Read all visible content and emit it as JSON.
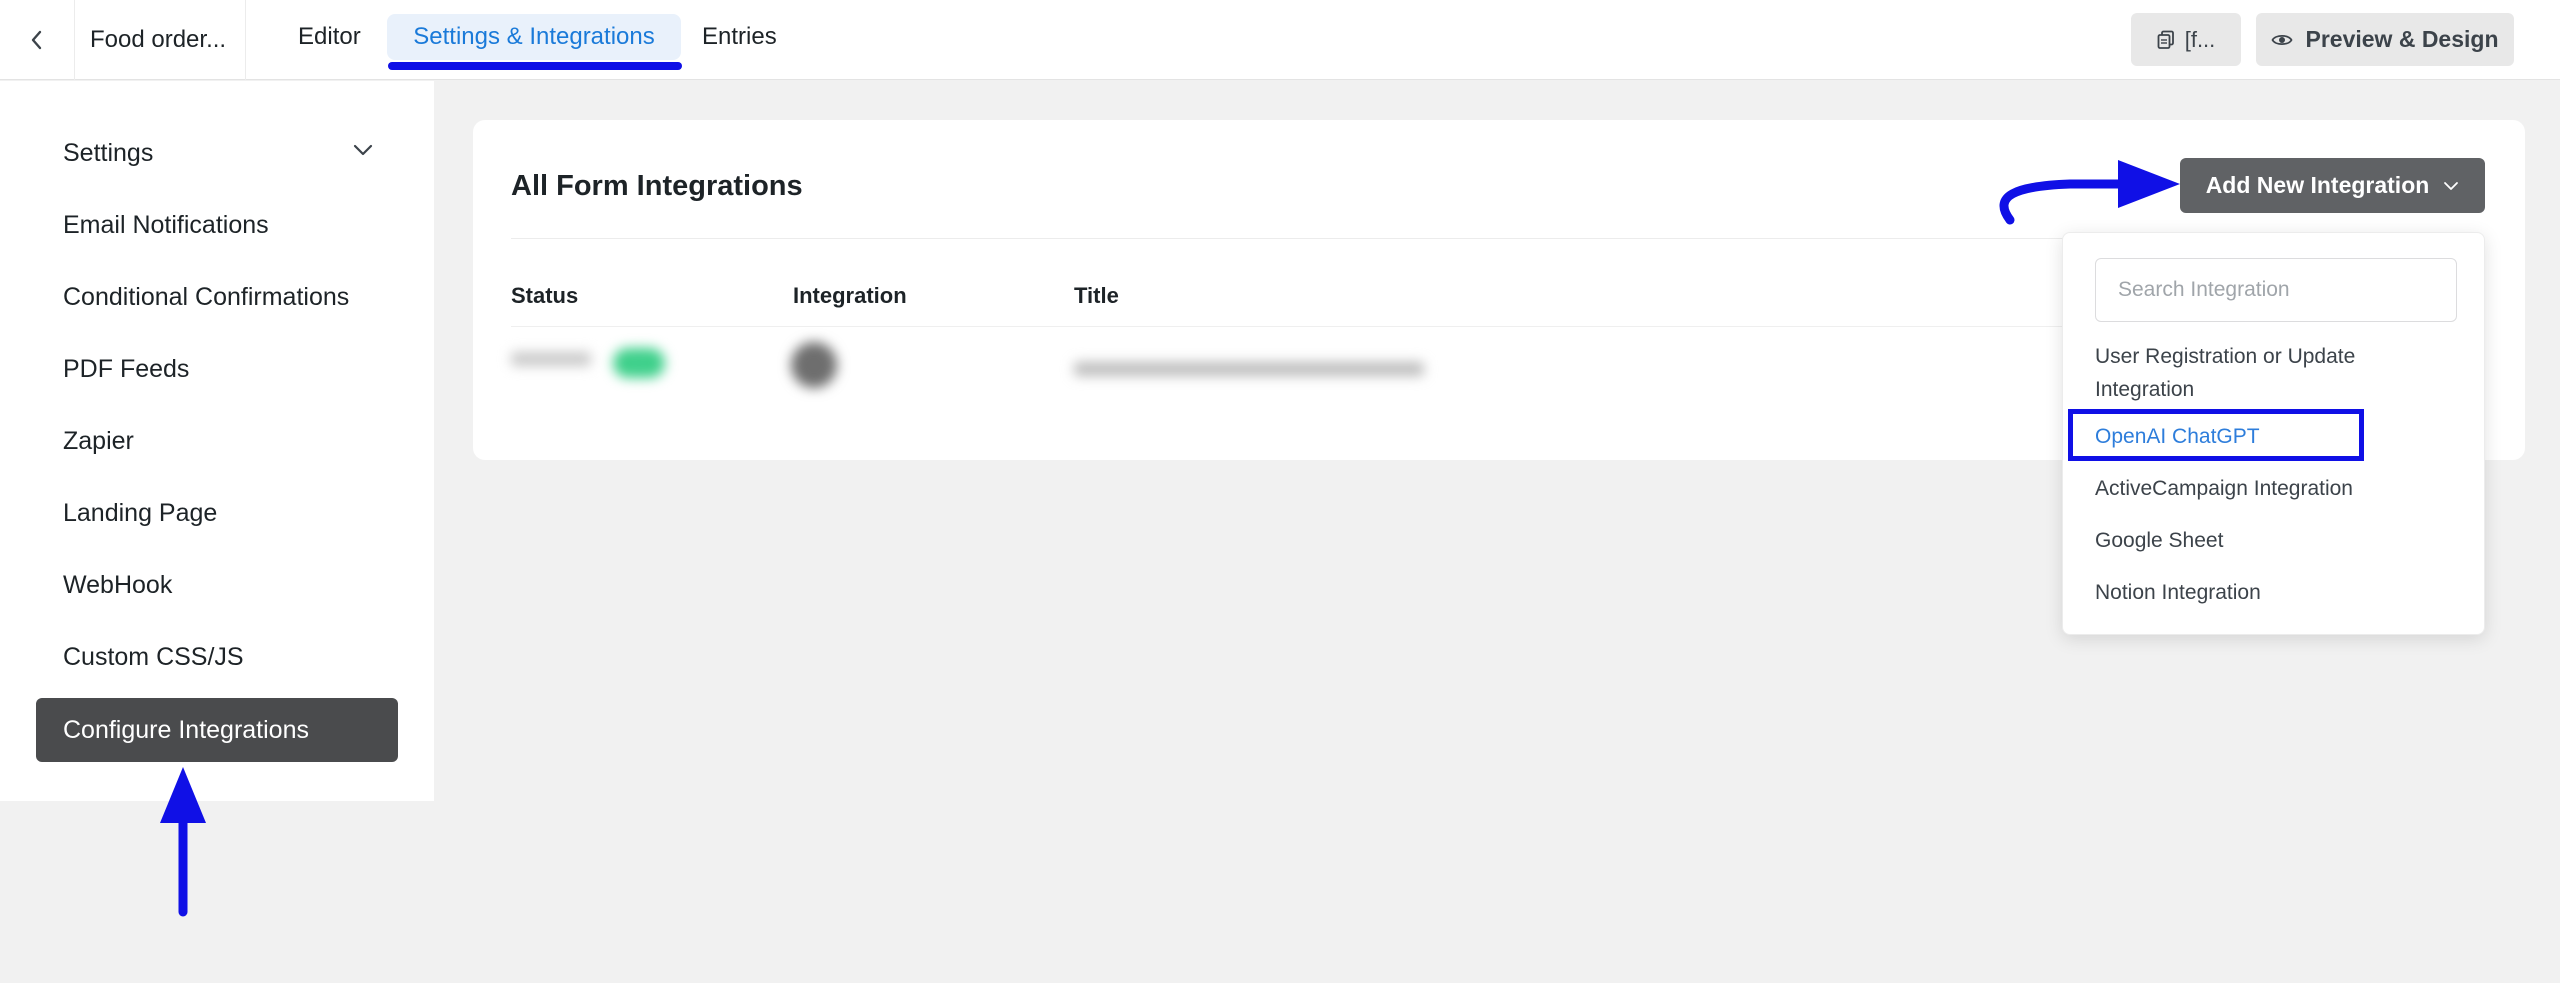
{
  "topbar": {
    "form_name": "Food order...",
    "tabs": [
      {
        "label": "Editor",
        "active": false
      },
      {
        "label": "Settings & Integrations",
        "active": true
      },
      {
        "label": "Entries",
        "active": false
      }
    ],
    "copy_button_label": "[f...",
    "preview_button_label": "Preview & Design",
    "accent_color": "#1a7ad9"
  },
  "sidebar": {
    "items": [
      {
        "label": "Settings",
        "active": false,
        "has_chevron": true
      },
      {
        "label": "Email Notifications",
        "active": false
      },
      {
        "label": "Conditional Confirmations",
        "active": false
      },
      {
        "label": "PDF Feeds",
        "active": false
      },
      {
        "label": "Zapier",
        "active": false
      },
      {
        "label": "Landing Page",
        "active": false
      },
      {
        "label": "WebHook",
        "active": false
      },
      {
        "label": "Custom CSS/JS",
        "active": false
      },
      {
        "label": "Configure Integrations",
        "active": true
      }
    ]
  },
  "main": {
    "title": "All Form Integrations",
    "add_button_label": "Add New Integration",
    "table": {
      "headers": [
        "Status",
        "Integration",
        "Title"
      ]
    }
  },
  "dropdown": {
    "search_placeholder": "Search Integration",
    "items": [
      {
        "label_line1": "User Registration or Update",
        "label_line2": "Integration",
        "highlighted": false
      },
      {
        "label": "OpenAI ChatGPT",
        "highlighted": true
      },
      {
        "label": "ActiveCampaign Integration",
        "highlighted": false
      },
      {
        "label": "Google Sheet",
        "highlighted": false
      },
      {
        "label": "Notion Integration",
        "highlighted": false
      }
    ]
  },
  "annotations": {
    "color": "#1010e6"
  },
  "icons": {
    "back": "chevron-left-icon",
    "copy": "copy-icon",
    "preview": "eye-icon",
    "dropdown": "chevron-down-icon"
  }
}
